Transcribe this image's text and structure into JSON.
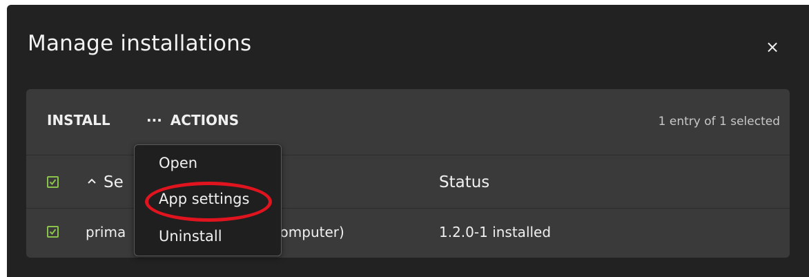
{
  "dialog": {
    "title": "Manage installations",
    "close_glyph": "×",
    "close_icon": "close-icon"
  },
  "toolbar": {
    "install_label": "INSTALL",
    "actions_dots": "···",
    "actions_icon": "more-horizontal-icon",
    "actions_label": "ACTIONS",
    "selection_text": "1 entry of 1 selected"
  },
  "table": {
    "columns": [
      {
        "label": "Se",
        "sort": "ascending",
        "sort_glyph": "^"
      },
      {
        "label": "Status"
      }
    ],
    "header_checked": true,
    "rows": [
      {
        "checked": true,
        "service_visible_text": "prima",
        "service_visible_tail": "is computer)",
        "status": "1.2.0-1 installed"
      }
    ]
  },
  "actions_menu": {
    "open": true,
    "items": [
      {
        "label": "Open"
      },
      {
        "label": "App settings",
        "highlighted": true
      },
      {
        "label": "Uninstall"
      }
    ]
  },
  "colors": {
    "dialog_bg": "#222222",
    "panel_bg": "#3a3a3a",
    "checkbox": "#8bc34a",
    "highlight_ring": "#e0141e"
  }
}
